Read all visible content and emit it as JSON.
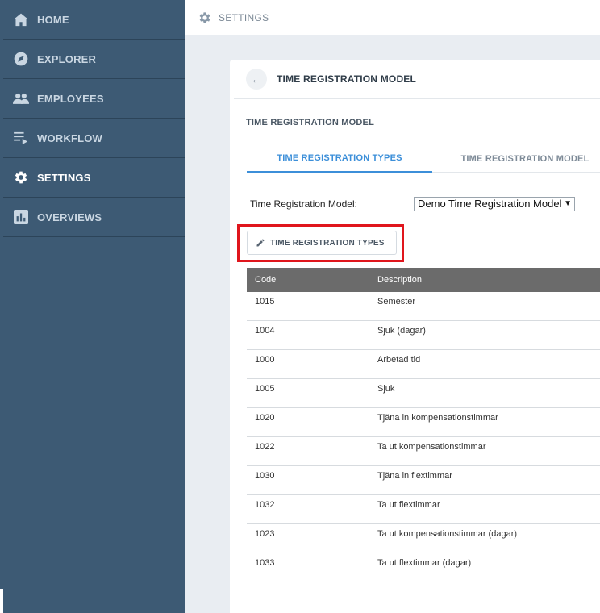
{
  "sidebar": {
    "items": [
      {
        "label": "HOME",
        "icon": "home-icon"
      },
      {
        "label": "EXPLORER",
        "icon": "compass-icon"
      },
      {
        "label": "EMPLOYEES",
        "icon": "people-icon"
      },
      {
        "label": "WORKFLOW",
        "icon": "workflow-icon"
      },
      {
        "label": "SETTINGS",
        "icon": "gear-icon",
        "active": true
      },
      {
        "label": "OVERVIEWS",
        "icon": "bar-chart-icon"
      }
    ]
  },
  "topbar": {
    "title": "SETTINGS",
    "icon": "gear-icon"
  },
  "card": {
    "title": "TIME REGISTRATION MODEL",
    "back_icon": "arrow-left-icon",
    "section_title": "TIME REGISTRATION MODEL",
    "tabs": [
      {
        "label": "TIME REGISTRATION TYPES",
        "active": true
      },
      {
        "label": "TIME REGISTRATION MODEL"
      }
    ],
    "model_field": {
      "label": "Time Registration Model:",
      "value": "Demo Time Registration Model"
    },
    "edit_button": {
      "label": "TIME REGISTRATION TYPES",
      "icon": "pencil-icon"
    },
    "table": {
      "columns": [
        "Code",
        "Description"
      ],
      "rows": [
        {
          "code": "1015",
          "description": "Semester"
        },
        {
          "code": "1004",
          "description": "Sjuk (dagar)"
        },
        {
          "code": "1000",
          "description": "Arbetad tid"
        },
        {
          "code": "1005",
          "description": "Sjuk"
        },
        {
          "code": "1020",
          "description": "Tjäna in kompensationstimmar"
        },
        {
          "code": "1022",
          "description": "Ta ut kompensationstimmar"
        },
        {
          "code": "1030",
          "description": "Tjäna in flextimmar"
        },
        {
          "code": "1032",
          "description": "Ta ut flextimmar"
        },
        {
          "code": "1023",
          "description": "Ta ut kompensationstimmar (dagar)"
        },
        {
          "code": "1033",
          "description": "Ta ut flextimmar (dagar)"
        }
      ]
    }
  },
  "colors": {
    "sidebar": "#3d5a74",
    "accent": "#3c8fd9",
    "highlight": "#e0161d",
    "table_header": "#6b6b6b"
  }
}
